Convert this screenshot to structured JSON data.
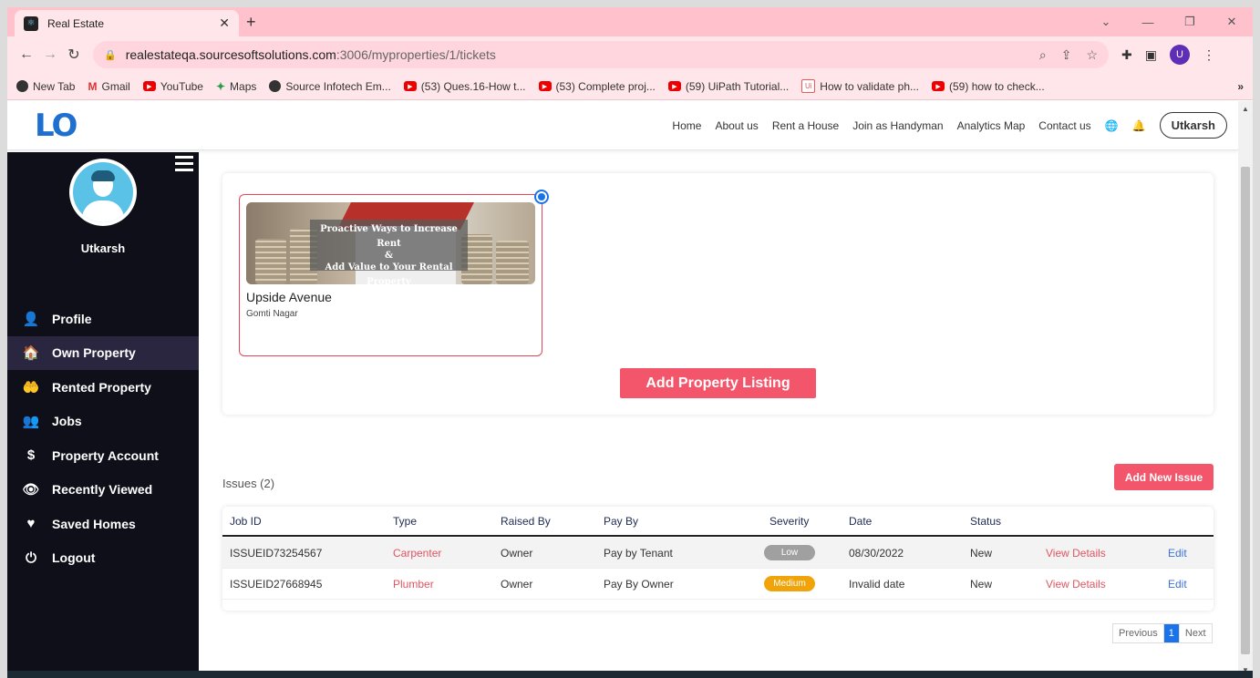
{
  "browser": {
    "tab_title": "Real Estate",
    "tab_close": "✕",
    "new_tab": "+",
    "url_host": "realestateqa.sourcesoftsolutions.com",
    "url_path": ":3006/myproperties/1/tickets",
    "profile_initial": "U",
    "bookmarks": [
      {
        "label": "New Tab",
        "icon": "globe-icon"
      },
      {
        "label": "Gmail",
        "icon": "gmail-icon"
      },
      {
        "label": "YouTube",
        "icon": "youtube-icon"
      },
      {
        "label": "Maps",
        "icon": "maps-icon"
      },
      {
        "label": "Source Infotech Em...",
        "icon": "globe-icon"
      },
      {
        "label": "(53) Ques.16-How t...",
        "icon": "youtube-icon"
      },
      {
        "label": "(53) Complete proj...",
        "icon": "youtube-icon"
      },
      {
        "label": "(59) UiPath Tutorial...",
        "icon": "youtube-icon"
      },
      {
        "label": "How to validate ph...",
        "icon": "uipath-icon"
      },
      {
        "label": "(59) how to check...",
        "icon": "youtube-icon"
      }
    ],
    "bookmarks_more": "»"
  },
  "navbar": {
    "logo": "LO",
    "links": [
      "Home",
      "About us",
      "Rent a House",
      "Join as Handyman",
      "Analytics Map",
      "Contact us"
    ],
    "user_button": "Utkarsh"
  },
  "sidebar": {
    "username": "Utkarsh",
    "items": [
      {
        "label": "Profile",
        "icon": "user-icon",
        "glyph": "👤",
        "active": false
      },
      {
        "label": "Own Property",
        "icon": "house-icon",
        "glyph": "🏠",
        "active": true
      },
      {
        "label": "Rented Property",
        "icon": "hand-house-icon",
        "glyph": "🤲",
        "active": false
      },
      {
        "label": "Jobs",
        "icon": "people-icon",
        "glyph": "👥",
        "active": false
      },
      {
        "label": "Property Account",
        "icon": "dollar-icon",
        "glyph": "$",
        "active": false
      },
      {
        "label": "Recently Viewed",
        "icon": "eye-icon",
        "glyph": "👁",
        "active": false
      },
      {
        "label": "Saved Homes",
        "icon": "heart-icon",
        "glyph": "♥",
        "active": false
      },
      {
        "label": "Logout",
        "icon": "power-icon",
        "glyph": "⏻",
        "active": false
      }
    ]
  },
  "property": {
    "image_text_1": "Proactive Ways to Increase Rent",
    "image_text_2": "&",
    "image_text_3": "Add Value to Your Rental Property",
    "title": "Upside Avenue",
    "location": "Gomti Nagar",
    "add_listing": "Add Property Listing"
  },
  "issues": {
    "label": "Issues (2)",
    "add_button": "Add New Issue",
    "columns": [
      "Job ID",
      "Type",
      "Raised By",
      "Pay By",
      "Severity",
      "Date",
      "Status"
    ],
    "rows": [
      {
        "job_id": "ISSUEID73254567",
        "type": "Carpenter",
        "raised_by": "Owner",
        "pay_by": "Pay by Tenant",
        "severity": "Low",
        "date": "08/30/2022",
        "status": "New",
        "view": "View Details",
        "edit": "Edit"
      },
      {
        "job_id": "ISSUEID27668945",
        "type": "Plumber",
        "raised_by": "Owner",
        "pay_by": "Pay By Owner",
        "severity": "Medium",
        "date": "Invalid date",
        "status": "New",
        "view": "View Details",
        "edit": "Edit"
      }
    ]
  },
  "pagination": {
    "prev": "Previous",
    "current": "1",
    "next": "Next"
  },
  "colors": {
    "accent": "#f3566a",
    "sidebar": "#0f0f1a",
    "link_blue": "#3d73d9",
    "tab_bar": "#ffc1cc"
  }
}
